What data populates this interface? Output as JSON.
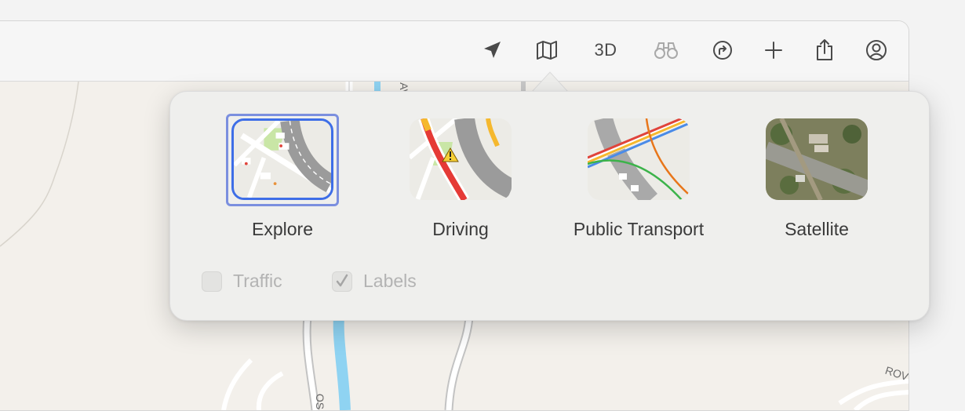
{
  "toolbar": {
    "three_d_label": "3D",
    "icons": [
      "location-arrow-icon",
      "map-icon",
      "binoculars-icon",
      "directions-icon",
      "plus-icon",
      "share-icon",
      "account-icon"
    ]
  },
  "map": {
    "labels": [
      "OS",
      "ROV",
      "AV"
    ]
  },
  "popover": {
    "modes": [
      {
        "label": "Explore",
        "selected": true
      },
      {
        "label": "Driving",
        "selected": false
      },
      {
        "label": "Public Transport",
        "selected": false
      },
      {
        "label": "Satellite",
        "selected": false
      }
    ],
    "options": [
      {
        "label": "Traffic",
        "checked": false,
        "enabled": false
      },
      {
        "label": "Labels",
        "checked": true,
        "enabled": false
      }
    ]
  },
  "colors": {
    "selection_accent": "#3e6ee7",
    "map_background": "#f3f0eb",
    "water": "#8fd3f2"
  }
}
